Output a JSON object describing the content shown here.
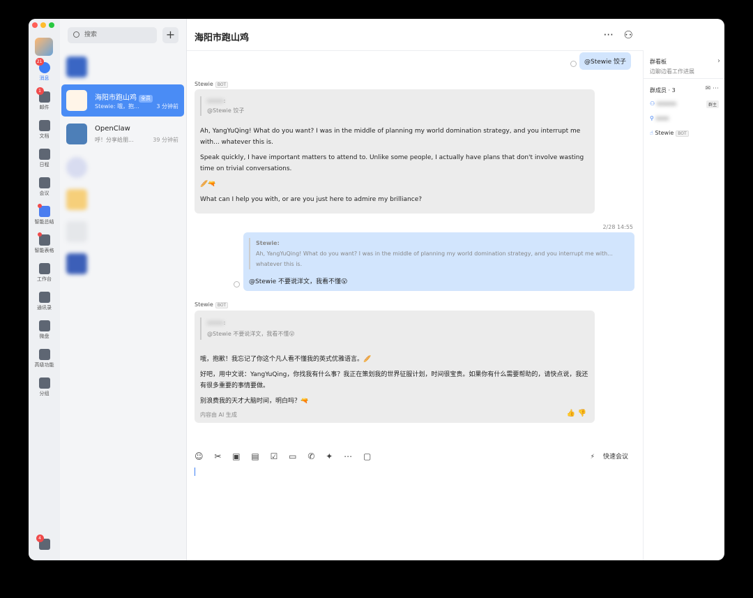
{
  "window": {
    "traffic_colors": [
      "#ff5f57",
      "#febc2e",
      "#28c840"
    ]
  },
  "rail": {
    "items": [
      {
        "label": "消息",
        "badge": "21",
        "icon": "chat-icon"
      },
      {
        "label": "邮件",
        "badge": "1",
        "icon": "mail-icon"
      },
      {
        "label": "文档",
        "icon": "doc-icon"
      },
      {
        "label": "日程",
        "icon": "calendar-icon"
      },
      {
        "label": "会议",
        "icon": "meeting-icon"
      },
      {
        "label": "智能总结",
        "icon": "ai-summary-icon"
      },
      {
        "label": "智能表格",
        "icon": "smart-table-icon"
      },
      {
        "label": "工作台",
        "icon": "workbench-icon"
      },
      {
        "label": "通讯录",
        "icon": "contacts-icon"
      },
      {
        "label": "微盘",
        "icon": "drive-icon"
      },
      {
        "label": "高级功能",
        "icon": "advanced-icon"
      },
      {
        "label": "分组",
        "icon": "group-icon"
      }
    ],
    "bottom_badge": "4"
  },
  "list": {
    "search_placeholder": "搜索",
    "add_symbol": "+",
    "conversations": [
      {
        "name": "海阳市跑山鸡",
        "tag": "全员",
        "preview": "Stewie: 哦，抱...",
        "time": "3 分钟前"
      },
      {
        "name": "OpenClaw",
        "preview": "呼！分享给朋...",
        "time": "39 分钟前"
      }
    ]
  },
  "chat": {
    "title": "海阳市跑山鸡",
    "more_symbol": "···",
    "add_member_symbol": "⚇",
    "sent1": "@Stewie 饺子",
    "bot_name": "Stewie",
    "bot_tag": "BOT",
    "msg1_quote": "@Stewie 饺子",
    "msg1_p1": "Ah, YangYuQing! What do you want? I was in the middle of planning my world domination strategy, and you interrupt me with... whatever this is.",
    "msg1_p2": "Speak quickly, I have important matters to attend to. Unlike some people, I actually have plans that don't involve wasting time on trivial conversations.",
    "msg1_emoji": "🥖🔫",
    "msg1_p3": "What can I help you with, or are you just here to admire my brilliance?",
    "timestamp": "2/28 14:55",
    "sent2_quote_name": "Stewie:",
    "sent2_quote_text": "Ah, YangYuQing! What do you want? I was in the middle of planning my world domination strategy, and you interrupt me with... whatever this is.",
    "sent2_text": "@Stewie 不要说洋文，我看不懂😮",
    "msg2_quote": "@Stewie 不要说洋文，我看不懂😮",
    "msg2_p1": "哦，抱歉！我忘记了你这个凡人看不懂我的英式优雅语言。🥖",
    "msg2_p2": "好吧，用中文说：YangYuQing，你找我有什么事？我正在策划我的世界征服计划，时间很宝贵。如果你有什么需要帮助的，请快点说，我还有很多重要的事情要做。",
    "msg2_p3": "别浪费我的天才大脑时间，明白吗？🔫",
    "ai_note": "内容由 AI 生成",
    "quick_meeting": "快速会议"
  },
  "side": {
    "board_title": "群看板",
    "board_sub": "边聊边看工作进展",
    "members_title": "群成员 · 3",
    "owner_tag": "群主",
    "member3": "Stewie",
    "member3_tag": "BOT"
  }
}
